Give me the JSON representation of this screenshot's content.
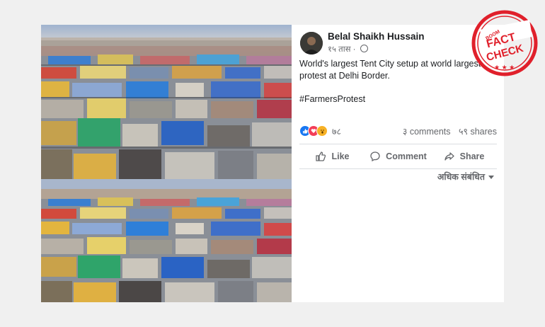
{
  "post": {
    "author": "Belal Shaikh Hussain",
    "time": "१५ तास",
    "caption": "World's largest Tent City setup at world largest protest at Delhi Border.",
    "hashtag": "#FarmersProtest",
    "reaction_count": "७८",
    "comments": "३ comments",
    "shares": "५९ shares",
    "actions": {
      "like": "Like",
      "comment": "Comment",
      "share": "Share"
    },
    "more_relevant": "अधिक संबंधित"
  },
  "images": {
    "top_alt": "aerial view of tent city",
    "bottom_alt": "aerial view of tent city"
  },
  "stamp": {
    "brand": "BOOM",
    "line1": "FACT",
    "line2": "CHECK",
    "color": "#e0202b"
  },
  "colors": {
    "link": "#1877f2",
    "muted": "#65676b"
  },
  "icons": [
    "like-reaction-icon",
    "love-reaction-icon",
    "wow-reaction-icon",
    "globe-icon",
    "thumbs-up-icon",
    "comment-icon",
    "share-icon",
    "chevron-down-icon"
  ]
}
